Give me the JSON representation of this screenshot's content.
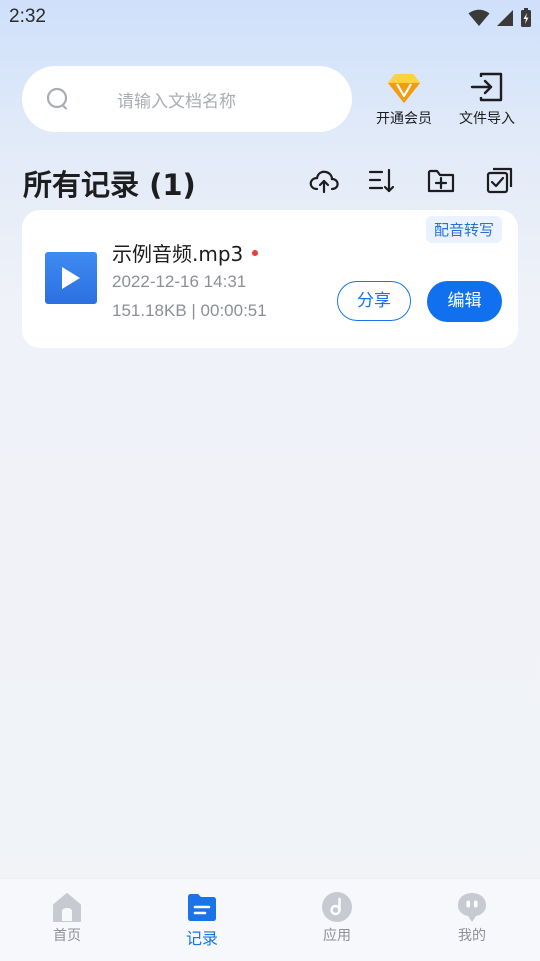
{
  "status_bar": {
    "time": "2:32"
  },
  "search": {
    "placeholder": "请输入文档名称"
  },
  "top_actions": {
    "vip_label": "开通会员",
    "import_label": "文件导入"
  },
  "section": {
    "title": "所有记录 (1)"
  },
  "records": [
    {
      "tag": "配音转写",
      "name": "示例音频.mp3",
      "date": "2022-12-16 14:31",
      "meta": "151.18KB | 00:00:51",
      "share_label": "分享",
      "edit_label": "编辑"
    }
  ],
  "bottom_nav": {
    "items": [
      {
        "label": "首页",
        "icon": "home-icon"
      },
      {
        "label": "记录",
        "icon": "records-icon",
        "active": true
      },
      {
        "label": "应用",
        "icon": "music-note-icon"
      },
      {
        "label": "我的",
        "icon": "profile-icon"
      }
    ]
  },
  "colors": {
    "accent": "#1a73e8",
    "tag_bg": "#eaf2fe",
    "unread_dot": "#ef3b3b",
    "inactive_nav": "#c7cbd1"
  }
}
